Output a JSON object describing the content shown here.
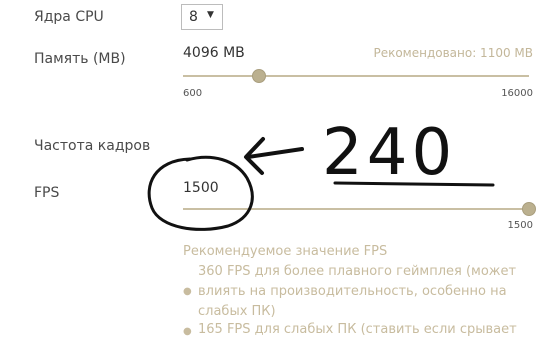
{
  "cpu": {
    "label": "Ядра CPU",
    "value": "8"
  },
  "memory": {
    "label": "Память (MB)",
    "value": "4096 MB",
    "recommended": "Рекомендовано: 1100 MB",
    "min": "600",
    "max": "16000",
    "slider_fraction": 0.22
  },
  "framerate": {
    "section_title": "Частота кадров",
    "label": "FPS",
    "value": "1500",
    "max": "1500",
    "slider_fraction": 1.0,
    "hint_title": "Рекомендуемое значение FPS",
    "hint_items": [
      [
        "360 FPS для более плавного геймплея (может",
        "влиять на производительность, особенно на",
        "слабых ПК)"
      ],
      [
        "165 FPS для слабых ПК (ставить если срывает"
      ]
    ]
  },
  "annotation": {
    "text": "240"
  }
}
